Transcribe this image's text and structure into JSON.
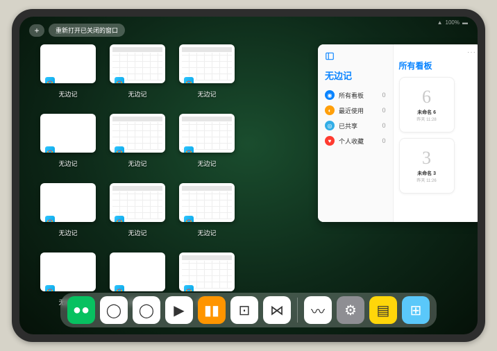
{
  "status": {
    "wifi": "􀙇",
    "battery": "100%"
  },
  "topbar": {
    "plus": "+",
    "reopen": "重新打开已关闭的窗口"
  },
  "window_grid": {
    "app_name": "无边记",
    "items": [
      {
        "style": "blank"
      },
      {
        "style": "cal"
      },
      {
        "style": "cal"
      },
      null,
      {
        "style": "blank"
      },
      {
        "style": "cal"
      },
      {
        "style": "cal"
      },
      null,
      {
        "style": "blank"
      },
      {
        "style": "cal"
      },
      {
        "style": "cal"
      },
      null,
      {
        "style": "blank"
      },
      {
        "style": "blank"
      },
      {
        "style": "cal"
      },
      null
    ]
  },
  "panel": {
    "left": {
      "title": "无边记",
      "items": [
        {
          "icon_color": "#0a84ff",
          "label": "所有看板",
          "count": 0
        },
        {
          "icon_color": "#ff9f0a",
          "label": "最近使用",
          "count": 0
        },
        {
          "icon_color": "#32ade6",
          "label": "已共享",
          "count": 0
        },
        {
          "icon_color": "#ff3b30",
          "label": "个人收藏",
          "count": 0
        }
      ]
    },
    "right": {
      "title": "所有看板",
      "more": "···",
      "cards": [
        {
          "glyph": "6",
          "title": "未命名 6",
          "subtitle": "昨天 11:28"
        },
        {
          "glyph": "3",
          "title": "未命名 3",
          "subtitle": "昨天 11:26"
        }
      ]
    }
  },
  "dock": {
    "items": [
      {
        "name": "wechat",
        "bg": "#07c160",
        "glyph": "●●"
      },
      {
        "name": "quark",
        "bg": "#ffffff",
        "glyph": "◯"
      },
      {
        "name": "qqbrowser",
        "bg": "#ffffff",
        "glyph": "◯"
      },
      {
        "name": "play",
        "bg": "#ffffff",
        "glyph": "▶"
      },
      {
        "name": "books",
        "bg": "#ff9500",
        "glyph": "▮▮"
      },
      {
        "name": "blackdot",
        "bg": "#ffffff",
        "glyph": "⊡"
      },
      {
        "name": "connect",
        "bg": "#ffffff",
        "glyph": "⋈"
      }
    ],
    "recent": [
      {
        "name": "freeform",
        "bg": "#ffffff",
        "glyph": "〰"
      },
      {
        "name": "settings",
        "bg": "#8e8e93",
        "glyph": "⚙"
      },
      {
        "name": "notes",
        "bg": "#ffd60a",
        "glyph": "▤"
      },
      {
        "name": "widgets",
        "bg": "#5ac8fa",
        "glyph": "⊞"
      }
    ]
  }
}
